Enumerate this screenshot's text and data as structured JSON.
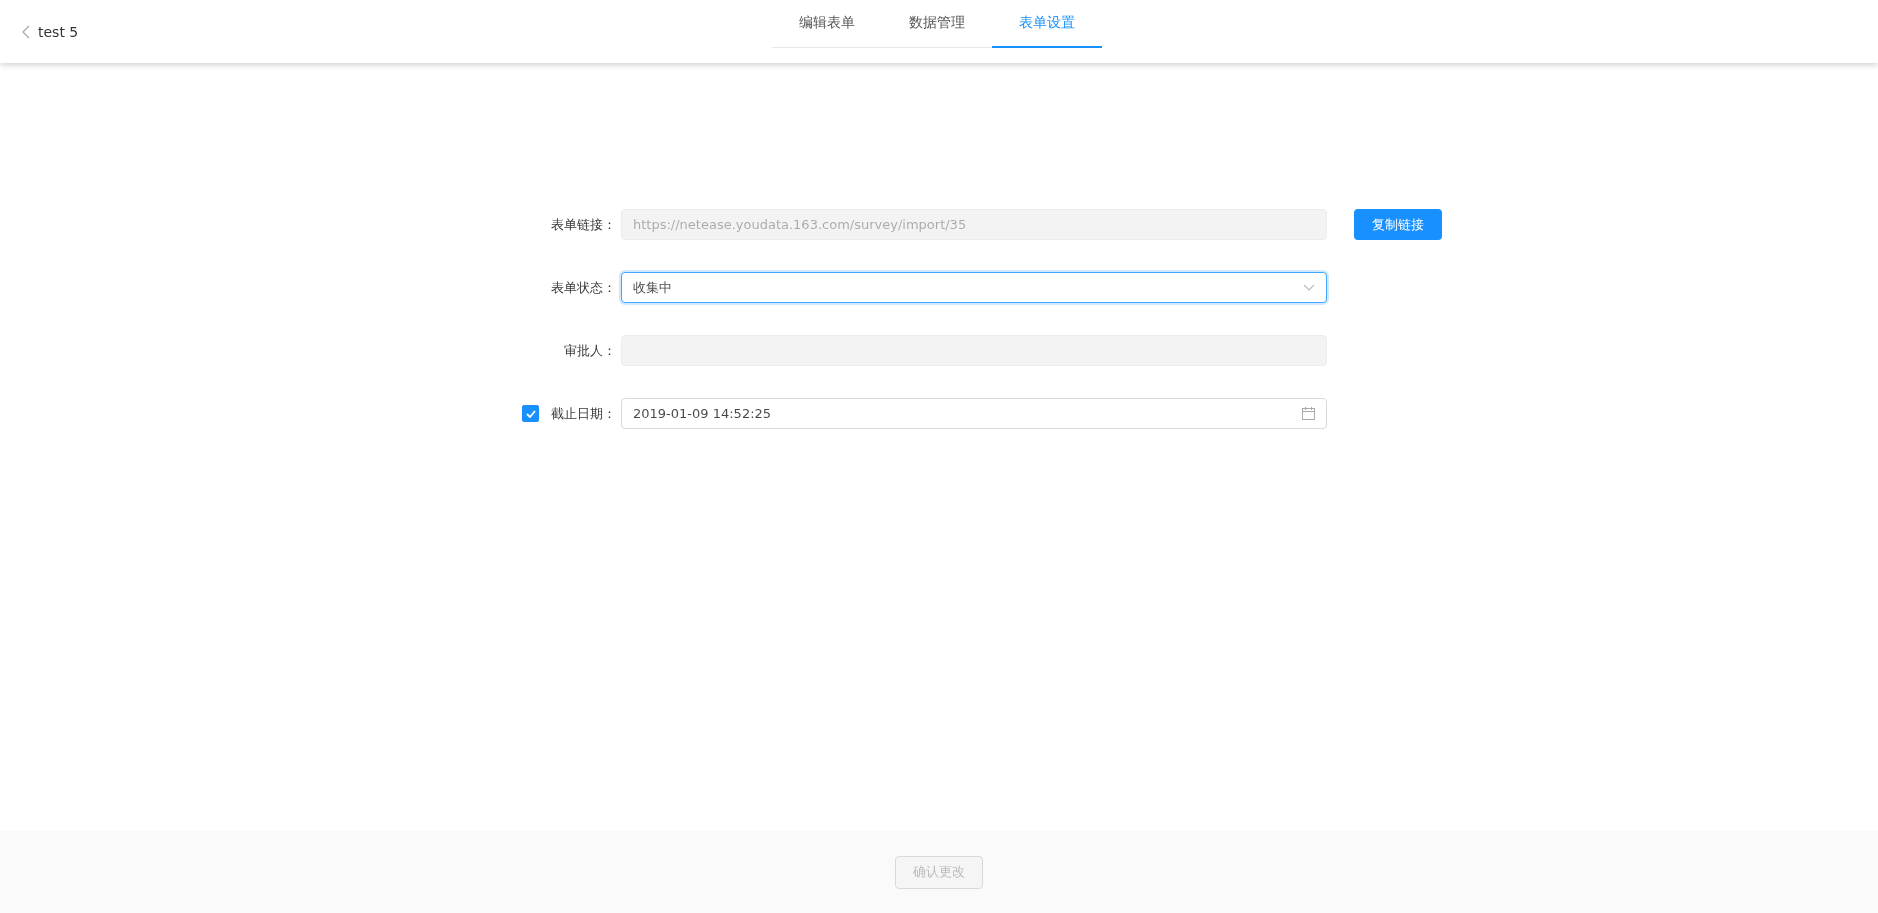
{
  "header": {
    "back_label": "test 5",
    "tabs": [
      {
        "label": "编辑表单",
        "selected": false
      },
      {
        "label": "数据管理",
        "selected": false
      },
      {
        "label": "表单设置",
        "selected": true
      }
    ]
  },
  "form": {
    "rows": [
      {
        "kind": "text",
        "label": "表单链接：",
        "value": "https://netease.youdata.163.com/survey/import/35",
        "disabled": true,
        "action": "复制链接"
      },
      {
        "kind": "select",
        "label": "表单状态：",
        "value": "收集中",
        "focused": true,
        "disabled": false
      },
      {
        "kind": "text",
        "label": "审批人：",
        "disabled": true
      },
      {
        "kind": "date",
        "label": "截止日期：",
        "value": "2019-01-09 14:52:25",
        "disabled": false,
        "checked": true
      }
    ]
  },
  "footer": {
    "confirm_button": {
      "label": "确认更改",
      "disabled": true
    }
  }
}
